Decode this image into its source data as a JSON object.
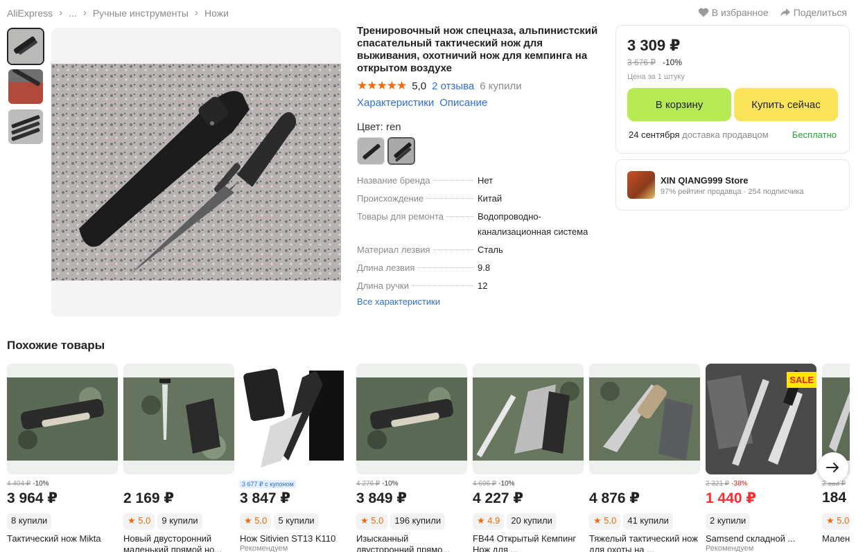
{
  "breadcrumb": {
    "items": [
      "AliExpress",
      "...",
      "Ручные инструменты",
      "Ножи"
    ]
  },
  "actions": {
    "favorite": "В избранное",
    "share": "Поделиться"
  },
  "product": {
    "title": "Тренировочный нож спецназа, альпинистский спасательный тактический нож для выживания, охотничий нож для кемпинга на открытом воздухе",
    "rating": "5,0",
    "reviews": "2 отзыва",
    "sold": "6 купили",
    "tab_specs": "Характеристики",
    "tab_desc": "Описание",
    "color_label": "Цвет: ren",
    "specs": [
      {
        "k": "Название бренда",
        "v": "Нет"
      },
      {
        "k": "Происхождение",
        "v": "Китай"
      },
      {
        "k": "Товары для ремонта",
        "v": "Водопроводно-канализационная система"
      },
      {
        "k": "Материал лезвия",
        "v": "Сталь"
      },
      {
        "k": "Длина лезвия",
        "v": "9.8"
      },
      {
        "k": "Длина ручки",
        "v": "12"
      }
    ],
    "all_specs": "Все характеристики"
  },
  "price": {
    "current": "3 309 ₽",
    "old": "3 676 ₽",
    "discount": "-10%",
    "per_unit": "Цена за 1 штуку",
    "cart_button": "В корзину",
    "buy_button": "Купить сейчас",
    "delivery_date": "24 сентября",
    "delivery_by": "доставка продавцом",
    "delivery_cost": "Бесплатно"
  },
  "store": {
    "name": "XIN QIANG999 Store",
    "rating": "97% рейтинг продавца",
    "subscribers": "254 подписчика"
  },
  "similar": {
    "title": "Похожие товары",
    "items": [
      {
        "old": "4 404 ₽",
        "disc": "-10%",
        "price": "3 964 ₽",
        "rating": "",
        "sold": "8 купили",
        "name": "Тактический нож Mikta",
        "rec": ""
      },
      {
        "old": "",
        "disc": "",
        "price": "2 169 ₽",
        "rating": "5.0",
        "sold": "9 купили",
        "name": "Новый двусторонний маленький прямой но...",
        "rec": ""
      },
      {
        "coupon": "3 677 ₽ с купоном",
        "price": "3 847 ₽",
        "rating": "5.0",
        "sold": "5 купили",
        "name": "Нож Sitivien ST13 K110",
        "rec": "Рекомендуем"
      },
      {
        "old": "4 276 ₽",
        "disc": "-10%",
        "price": "3 849 ₽",
        "rating": "5.0",
        "sold": "196 купили",
        "name": "Изысканный двусторонний прямо...",
        "rec": ""
      },
      {
        "old": "4 696 ₽",
        "disc": "-10%",
        "price": "4 227 ₽",
        "rating": "4.9",
        "sold": "20 купили",
        "name": "FB44 Открытый Кемпинг Нож для ...",
        "rec": ""
      },
      {
        "old": "",
        "disc": "",
        "price": "4 876 ₽",
        "rating": "5.0",
        "sold": "41 купили",
        "name": "Тяжелый тактический нож для охоты на ...",
        "rec": ""
      },
      {
        "old": "2 321 ₽",
        "disc": "-38%",
        "price": "1 440 ₽",
        "rating": "",
        "sold": "2 купили",
        "name": "Samsend складной ...",
        "rec": "Рекомендуем",
        "sale": "SALE"
      },
      {
        "old": "2 353 ₽",
        "disc": "",
        "price": "184",
        "rating": "5.0",
        "sold": "",
        "name": "Мален...",
        "rec": ""
      }
    ]
  },
  "icons": {
    "heart": "heart-icon",
    "share": "share-icon",
    "arrow": "arrow-right-icon"
  },
  "colors": {
    "link": "#2d6fe0",
    "cart": "#b6ea52",
    "buy": "#fbe35a",
    "star": "#f56a00",
    "free": "#2ba336",
    "sale_red": "#ff2d2d"
  }
}
